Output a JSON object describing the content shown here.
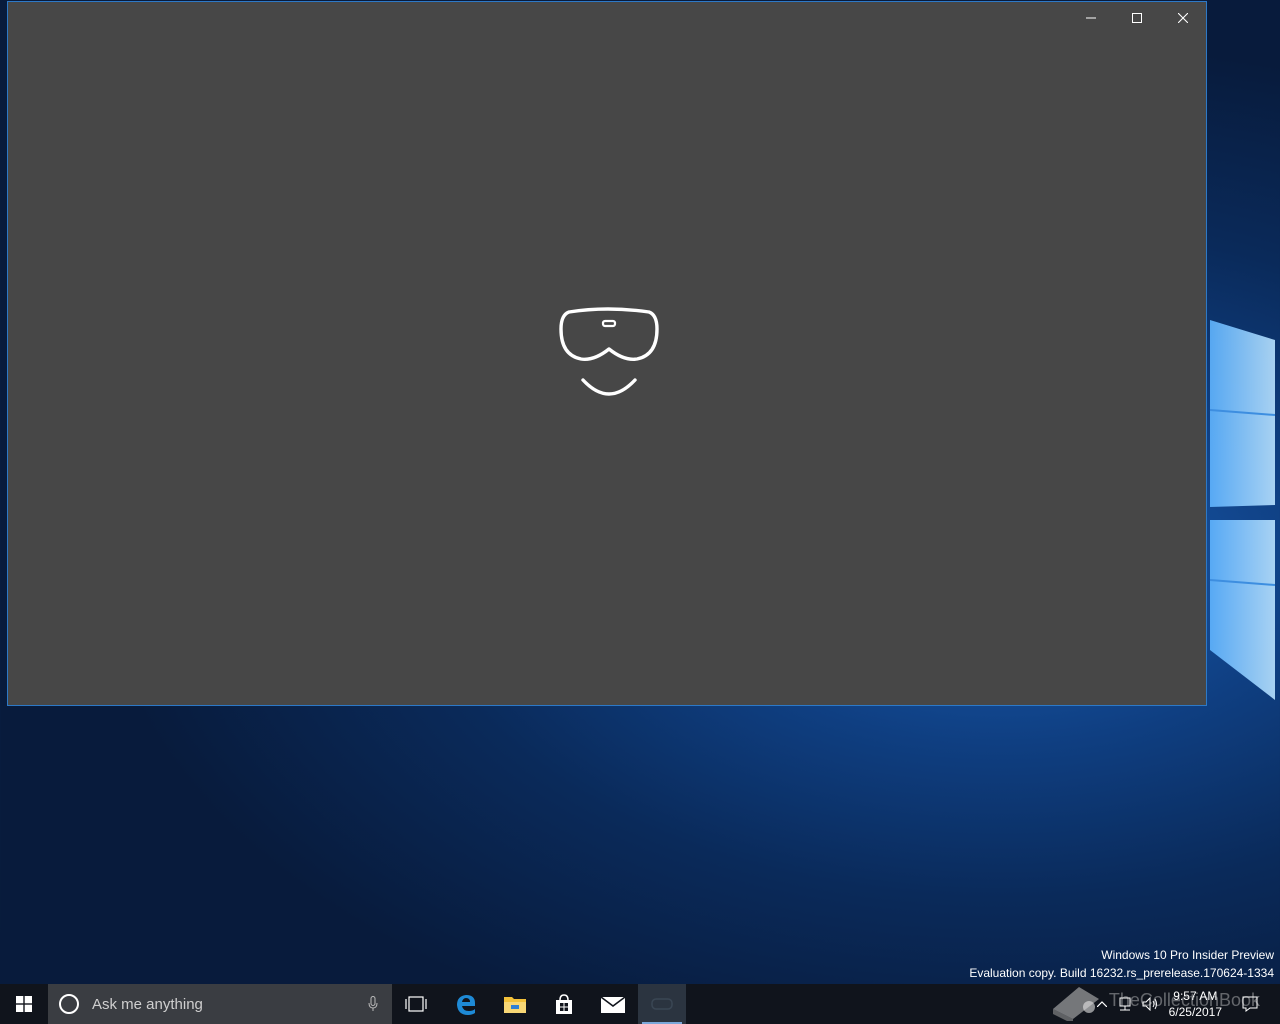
{
  "desktop": {
    "edition": "Windows 10 Pro Insider Preview",
    "build": "Evaluation copy. Build 16232.rs_prerelease.170624-1334"
  },
  "window": {
    "background": "#474747",
    "border_color": "#2d79c7",
    "icons": {
      "minimize": "minimize-icon",
      "maximize": "maximize-icon",
      "close": "close-icon",
      "center": "mixed-reality-headset-icon"
    }
  },
  "taskbar": {
    "search_placeholder": "Ask me anything",
    "pinned": [
      "task-view",
      "edge",
      "file-explorer",
      "store",
      "mail",
      "mixed-reality-portal"
    ],
    "clock": {
      "time": "9:57 AM",
      "date": "6/25/2017"
    },
    "watermark": "TheCollectionBook"
  }
}
